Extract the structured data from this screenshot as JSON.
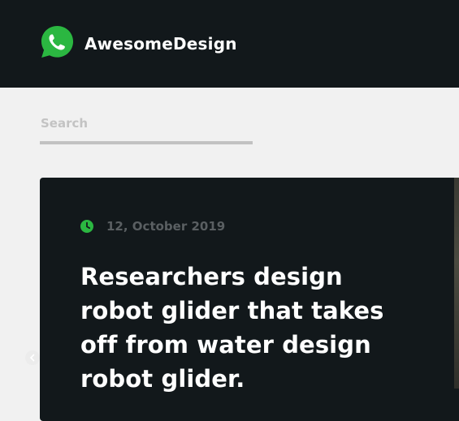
{
  "header": {
    "brand_name": "AwesomeDesign",
    "logo_icon": "whatsapp-logo-icon",
    "brand_color": "#2bb741",
    "background": "#12181b"
  },
  "search": {
    "placeholder": "Search",
    "value": ""
  },
  "article": {
    "date_icon": "clock-icon",
    "date": "12, October 2019",
    "title": "Researchers design robot glider that takes off from water design robot glider."
  },
  "carousel": {
    "prev_icon": "chevron-left-icon"
  }
}
